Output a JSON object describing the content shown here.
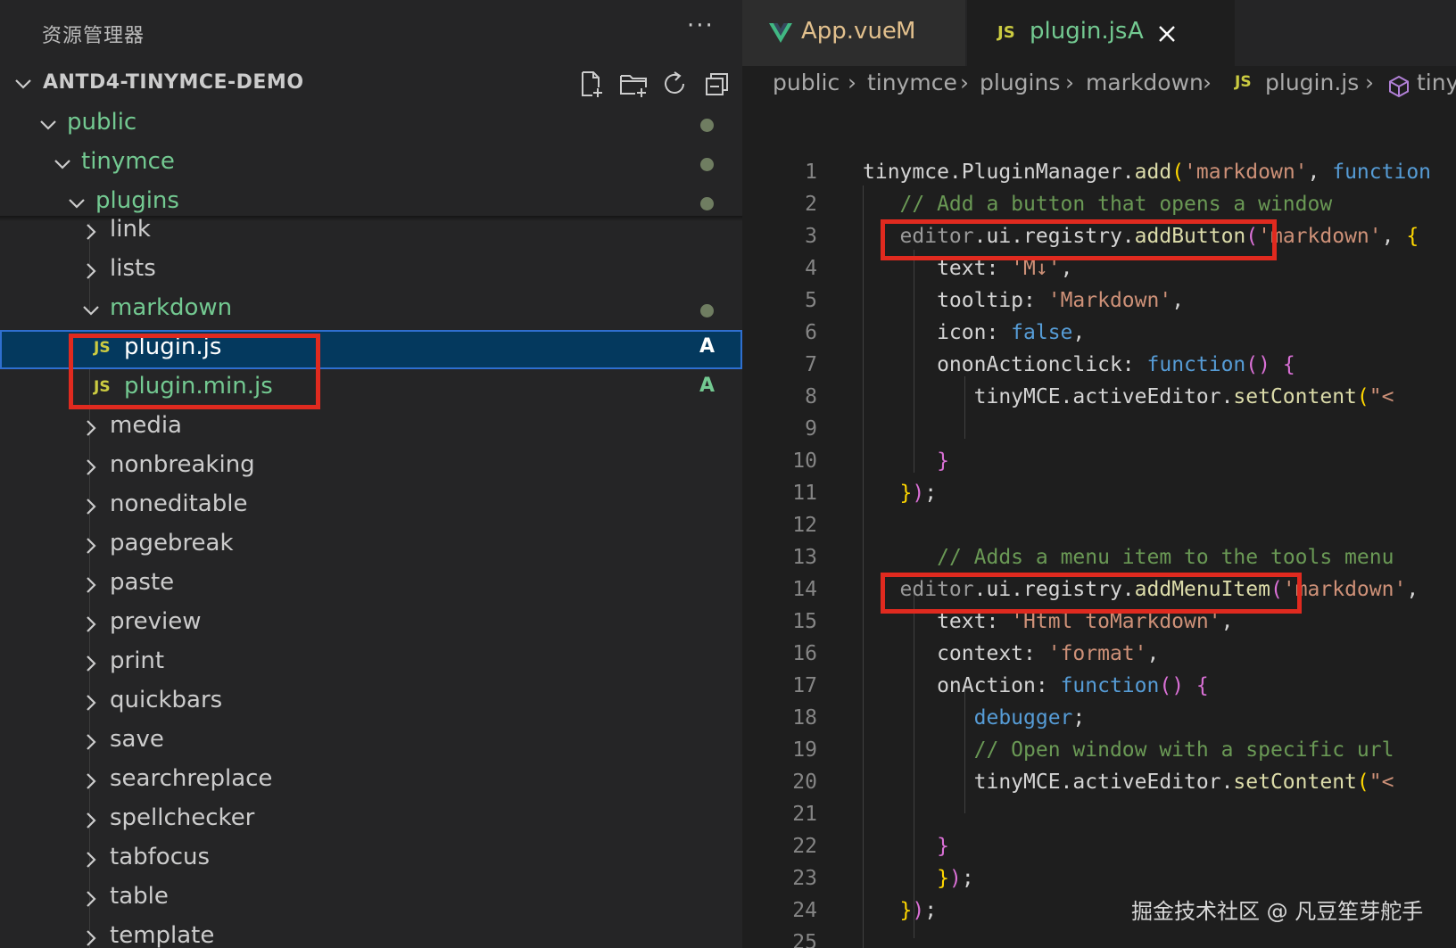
{
  "explorer": {
    "title": "资源管理器",
    "more": "···",
    "project": "ANTD4-TINYMCE-DEMO"
  },
  "tree": [
    {
      "label": "public",
      "expanded": true,
      "modified": true
    },
    {
      "label": "tinymce",
      "expanded": true,
      "modified": true
    },
    {
      "label": "plugins",
      "expanded": true,
      "modified": true
    },
    {
      "label": "link"
    },
    {
      "label": "lists"
    },
    {
      "label": "markdown",
      "expanded": true,
      "modified": true
    },
    {
      "label": "plugin.js",
      "badge": "JS",
      "git": "A",
      "selected": true
    },
    {
      "label": "plugin.min.js",
      "badge": "JS",
      "git": "A"
    },
    {
      "label": "media"
    },
    {
      "label": "nonbreaking"
    },
    {
      "label": "noneditable"
    },
    {
      "label": "pagebreak"
    },
    {
      "label": "paste"
    },
    {
      "label": "preview"
    },
    {
      "label": "print"
    },
    {
      "label": "quickbars"
    },
    {
      "label": "save"
    },
    {
      "label": "searchreplace"
    },
    {
      "label": "spellchecker"
    },
    {
      "label": "tabfocus"
    },
    {
      "label": "table"
    },
    {
      "label": "template"
    }
  ],
  "tabs": [
    {
      "label": "App.vue",
      "status": "M",
      "icon": "vue-icon"
    },
    {
      "label": "plugin.js",
      "status": "A",
      "icon": "js-icon",
      "badge": "JS",
      "active": true
    }
  ],
  "breadcrumb": [
    "public",
    "tinymce",
    "plugins",
    "markdown",
    "plugin.js",
    "tiny"
  ],
  "breadcrumb_js_badge": "JS",
  "code": {
    "line_numbers": [
      "1",
      "2",
      "3",
      "4",
      "5",
      "6",
      "7",
      "8",
      "9",
      "10",
      "11",
      "12",
      "13",
      "14",
      "15",
      "16",
      "17",
      "18",
      "19",
      "20",
      "21",
      "22",
      "23",
      "24",
      "25"
    ]
  },
  "watermark": "掘金技术社区 @ 凡豆笙芽舵手",
  "colors": {
    "accent_green": "#73c991",
    "js_yellow": "#cbcb41",
    "selection": "#04395e",
    "highlight_red": "#e02a1f"
  }
}
